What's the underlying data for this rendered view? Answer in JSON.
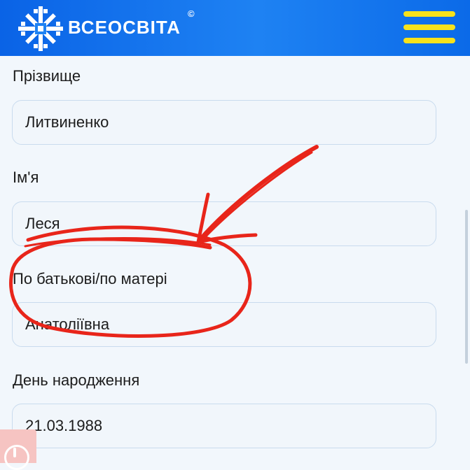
{
  "header": {
    "brand": "ВСЕОСВІТА",
    "copyright": "©",
    "logo_icon": "snowflake-icon",
    "menu_icon": "hamburger-menu-icon",
    "colors": {
      "header_bg": "#0a63e6",
      "menu": "#f7e21b"
    }
  },
  "form": {
    "surname": {
      "label": "Прізвище",
      "value": "Литвиненко"
    },
    "first_name": {
      "label": "Ім'я",
      "value": "Леся"
    },
    "patronymic": {
      "label": "По батькові/по матері",
      "value": "Анатоліївна"
    },
    "birthday": {
      "label": "День народження",
      "value": "21.03.1988"
    }
  },
  "alert_icon": "exclamation-circle-icon",
  "annotation": {
    "type": "hand-drawn red circle and arrow",
    "color": "#e8251a"
  }
}
